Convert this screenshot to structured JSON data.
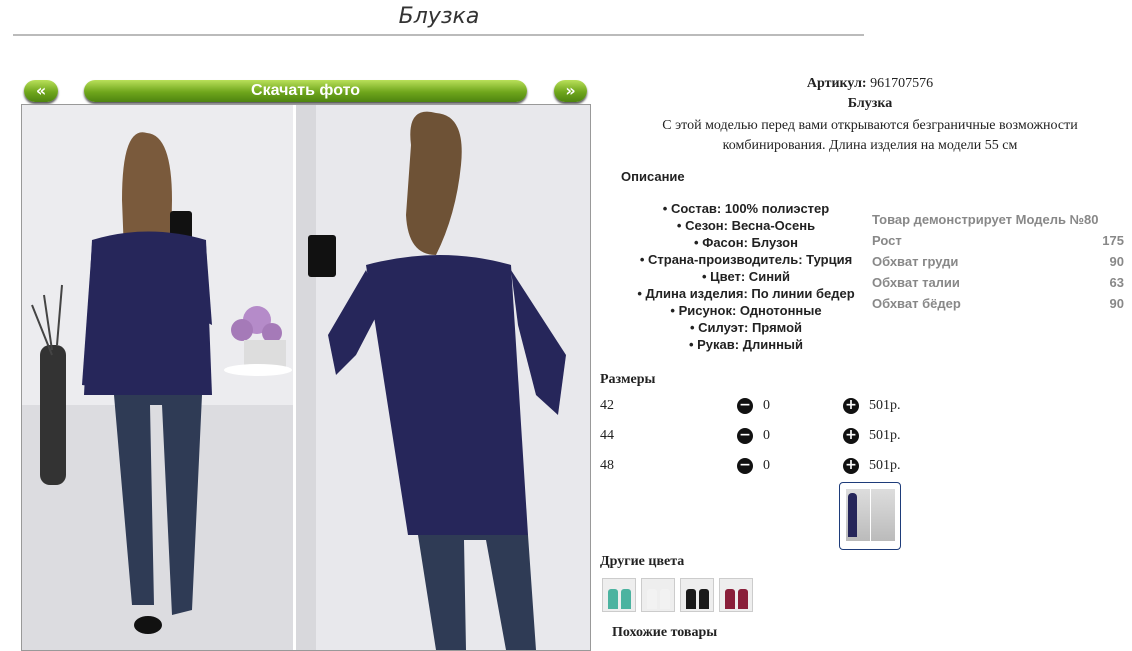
{
  "page": {
    "title": "Блузка"
  },
  "gallery": {
    "prev_label": "«",
    "next_label": "»",
    "download_label": "Скачать фото"
  },
  "product": {
    "sku_label": "Артикул:",
    "sku_value": "961707576",
    "name": "Блузка",
    "description": "С этой моделью перед вами открываются безграничные возможности комбинирования. Длина изделия на модели 55 см",
    "details_heading": "Описание",
    "attributes": [
      "Состав: 100% полиэстер",
      "Сезон: Весна-Осень",
      "Фасон: Блузон",
      "Страна-производитель: Турция",
      "Цвет: Синий",
      "Длина изделия: По линии бедер",
      "Рисунок: Однотонные",
      "Силуэт: Прямой",
      "Рукав: Длинный"
    ]
  },
  "model": {
    "heading": "Товар демонстрирует Модель №80",
    "rows": [
      {
        "label": "Рост",
        "value": "175"
      },
      {
        "label": "Обхват груди",
        "value": "90"
      },
      {
        "label": "Обхват талии",
        "value": "63"
      },
      {
        "label": "Обхват бёдер",
        "value": "90"
      }
    ]
  },
  "sizes": {
    "heading": "Размеры",
    "rows": [
      {
        "size": "42",
        "qty": "0",
        "price": "501р."
      },
      {
        "size": "44",
        "qty": "0",
        "price": "501р."
      },
      {
        "size": "48",
        "qty": "0",
        "price": "501р."
      }
    ]
  },
  "other_colors": {
    "heading": "Другие цвета",
    "swatch_colors": [
      "#4bb3a0",
      "#f2f2f2",
      "#1a1a1a",
      "#8a1f3a"
    ]
  },
  "similar": {
    "heading": "Похожие товары"
  },
  "colors": {
    "button_green": "#6fa61c",
    "blouse_navy": "#26265a"
  }
}
